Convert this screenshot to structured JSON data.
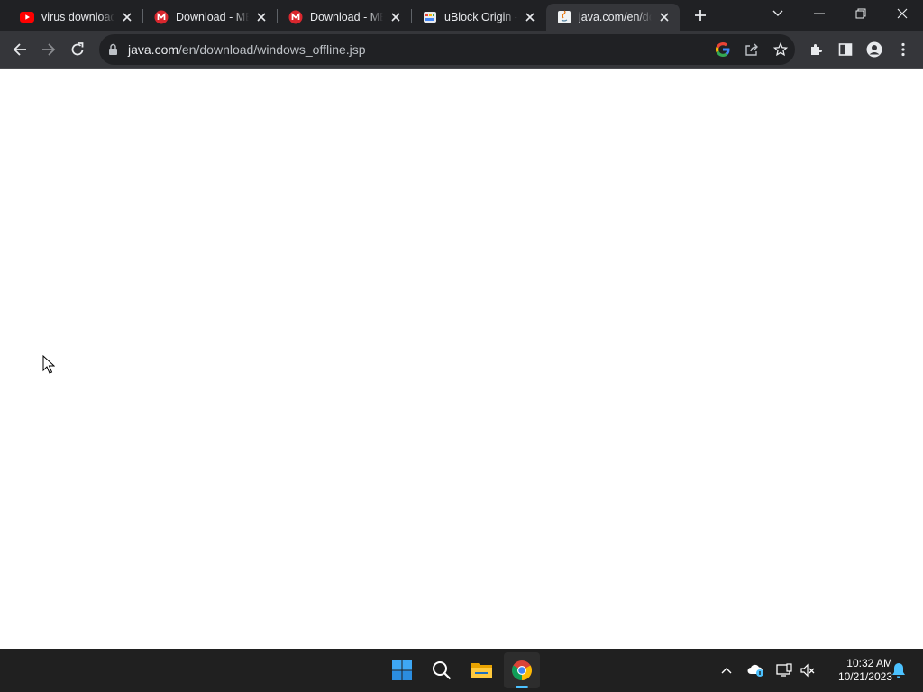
{
  "tabs": [
    {
      "title": "virus download - YouTube",
      "favicon": "youtube-icon",
      "active": false
    },
    {
      "title": "Download - MEGA",
      "favicon": "mega-icon",
      "active": false
    },
    {
      "title": "Download - MEGA",
      "favicon": "mega-icon",
      "active": false
    },
    {
      "title": "uBlock Origin - Free",
      "favicon": "ublock-icon",
      "active": false
    },
    {
      "title": "java.com/en/download",
      "favicon": "java-icon",
      "active": true
    }
  ],
  "address_bar": {
    "host": "java.com",
    "path": "/en/download/windows_offline.jsp"
  },
  "taskbar": {
    "apps": [
      "start-icon",
      "search-icon",
      "file-explorer-icon",
      "chrome-icon"
    ],
    "clock_time": "10:32 AM",
    "clock_date": "10/21/2023"
  },
  "colors": {
    "tabstrip_bg": "#202124",
    "toolbar_bg": "#35363a",
    "taskbar_bg": "#202020",
    "accent": "#4cc2ff"
  }
}
